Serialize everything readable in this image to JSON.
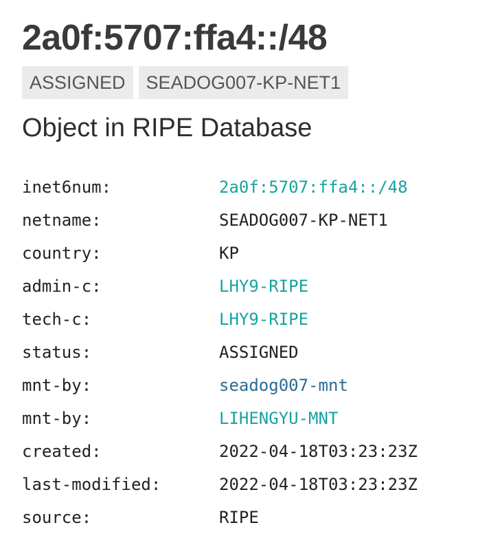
{
  "header": {
    "title": "2a0f:5707:ffa4::/48",
    "tags": [
      "ASSIGNED",
      "SEADOG007-KP-NET1"
    ]
  },
  "section": {
    "title": "Object in RIPE Database"
  },
  "colors": {
    "link": "#17a2a2",
    "link_visited": "#2b6a93",
    "tag_background": "#ebebeb"
  },
  "record": {
    "rows": [
      {
        "key": "inet6num:",
        "value": "2a0f:5707:ffa4::/48"
      },
      {
        "key": "netname:",
        "value": "SEADOG007-KP-NET1"
      },
      {
        "key": "country:",
        "value": "KP"
      },
      {
        "key": "admin-c:",
        "value": "LHY9-RIPE"
      },
      {
        "key": "tech-c:",
        "value": "LHY9-RIPE"
      },
      {
        "key": "status:",
        "value": "ASSIGNED"
      },
      {
        "key": "mnt-by:",
        "value": "seadog007-mnt"
      },
      {
        "key": "mnt-by:",
        "value": "LIHENGYU-MNT"
      },
      {
        "key": "created:",
        "value": "2022-04-18T03:23:23Z"
      },
      {
        "key": "last-modified:",
        "value": "2022-04-18T03:23:23Z"
      },
      {
        "key": "source:",
        "value": "RIPE"
      }
    ]
  }
}
